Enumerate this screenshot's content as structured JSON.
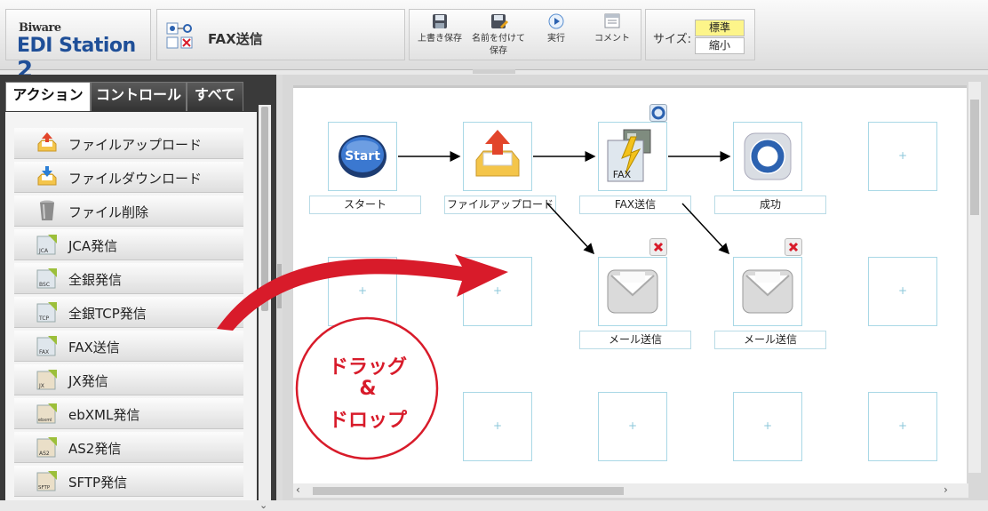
{
  "app": {
    "logo_top": "Biware",
    "logo_main": "EDI Station",
    "logo_version": "2"
  },
  "header": {
    "title": "FAX送信"
  },
  "toolbar": {
    "buttons": [
      {
        "label": "上書き保存",
        "icon": "floppy-save-icon"
      },
      {
        "label": "名前を付けて保存",
        "icon": "floppy-save-as-icon"
      },
      {
        "label": "実行",
        "icon": "play-icon"
      },
      {
        "label": "コメント",
        "icon": "comment-icon"
      }
    ],
    "size_label": "サイズ:",
    "size_options": [
      "標準",
      "縮小"
    ],
    "size_selected": "標準"
  },
  "sidebar": {
    "tabs": [
      {
        "label": "アクション",
        "active": true
      },
      {
        "label": "コントロール",
        "active": false
      },
      {
        "label": "すべて",
        "active": false
      }
    ],
    "items": [
      {
        "label": "ファイルアップロード",
        "icon": "file-upload-icon"
      },
      {
        "label": "ファイルダウンロード",
        "icon": "file-download-icon"
      },
      {
        "label": "ファイル削除",
        "icon": "trash-can-icon"
      },
      {
        "label": "JCA発信",
        "icon": "jca-icon",
        "icon_text": "JCA"
      },
      {
        "label": "全銀発信",
        "icon": "zengin-bsc-icon",
        "icon_text": "BSC"
      },
      {
        "label": "全銀TCP発信",
        "icon": "zengin-tcp-icon",
        "icon_text": "TCP"
      },
      {
        "label": "FAX送信",
        "icon": "fax-icon",
        "icon_text": "FAX"
      },
      {
        "label": "JX発信",
        "icon": "jx-icon",
        "icon_text": "JX"
      },
      {
        "label": "ebXML発信",
        "icon": "ebxml-icon",
        "icon_text": "ebxml"
      },
      {
        "label": "AS2発信",
        "icon": "as2-icon",
        "icon_text": "AS2"
      },
      {
        "label": "SFTP発信",
        "icon": "sftp-icon",
        "icon_text": "SFTP"
      }
    ]
  },
  "flow": {
    "nodes": [
      {
        "label": "スタート",
        "icon": "start-icon",
        "icon_text": "Start"
      },
      {
        "label": "ファイルアップロード",
        "icon": "file-upload-icon"
      },
      {
        "label": "FAX送信",
        "icon": "fax-machine-icon",
        "icon_text": "FAX"
      },
      {
        "label": "成功",
        "icon": "success-ring-icon"
      },
      {
        "label": "メール送信",
        "icon": "mail-icon"
      },
      {
        "label": "メール送信",
        "icon": "mail-icon"
      }
    ],
    "empty_cell_mark": "+"
  },
  "annotation": {
    "lines": [
      "ドラッグ",
      "&",
      "ドロップ"
    ]
  },
  "colors": {
    "accent_red": "#d81b2a",
    "cell_border": "#a9d8e6",
    "logo_blue": "#1f4f98"
  }
}
